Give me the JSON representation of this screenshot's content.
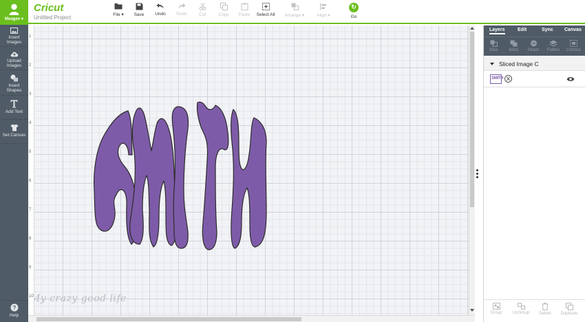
{
  "colors": {
    "accent": "#6abf1e",
    "sidebar": "#4f5b66",
    "letters": "#7e5ba8",
    "letters_stroke": "#2b2b2b"
  },
  "user": {
    "name": "Meagen",
    "icon": "user-icon"
  },
  "sidebar": {
    "items": [
      {
        "label_lines": [
          "Insert",
          "Images"
        ],
        "icon": "image-icon"
      },
      {
        "label_lines": [
          "Upload",
          "Images"
        ],
        "icon": "cloud-upload-icon"
      },
      {
        "label_lines": [
          "Insert",
          "Shapes"
        ],
        "icon": "shapes-icon"
      },
      {
        "label_lines": [
          "Add Text"
        ],
        "icon": "text-t-icon"
      },
      {
        "label_lines": [
          "Set Canvas"
        ],
        "icon": "tshirt-icon"
      }
    ],
    "help": {
      "label": "Help",
      "icon": "help-icon"
    }
  },
  "header": {
    "brand": "Cricut",
    "project_name": "Untitled Project",
    "toolbar": [
      {
        "label": "File ▾",
        "icon": "folder-icon",
        "enabled": true
      },
      {
        "label": "Save",
        "icon": "save-icon",
        "enabled": true
      },
      {
        "label": "Undo",
        "icon": "undo-icon",
        "enabled": true
      },
      {
        "label": "Redo",
        "icon": "redo-icon",
        "enabled": false
      },
      {
        "label": "Cut",
        "icon": "cut-icon",
        "enabled": false
      },
      {
        "label": "Copy",
        "icon": "copy-icon",
        "enabled": false
      },
      {
        "label": "Paste",
        "icon": "paste-icon",
        "enabled": false
      },
      {
        "label": "Select All",
        "icon": "select-all-icon",
        "enabled": true
      },
      {
        "label": "Arrange ▾",
        "icon": "arrange-icon",
        "enabled": false
      },
      {
        "label": "Align ▾",
        "icon": "align-icon",
        "enabled": false
      },
      {
        "label": "Go",
        "icon": "go-icon",
        "enabled": true
      }
    ]
  },
  "canvas": {
    "ruler_numbers": [
      "1",
      "2",
      "3",
      "4",
      "5",
      "6",
      "7",
      "8",
      "9",
      "10"
    ],
    "design_text": "SMITH",
    "watermark": "My crazy good life"
  },
  "panel": {
    "tabs": [
      "Layers",
      "Edit",
      "Sync",
      "Canvas"
    ],
    "active_tab": "Layers",
    "tools": [
      {
        "label": "Slice",
        "icon": "slice-icon"
      },
      {
        "label": "Weld",
        "icon": "weld-icon"
      },
      {
        "label": "Attach",
        "icon": "attach-icon"
      },
      {
        "label": "Flatten",
        "icon": "flatten-icon"
      },
      {
        "label": "Contour",
        "icon": "contour-icon"
      }
    ],
    "layer_group_name": "Sliced Image C",
    "layer_thumb_text": "SMITH",
    "bottom_tools": [
      {
        "label": "Group",
        "icon": "group-icon"
      },
      {
        "label": "UnGroup",
        "icon": "ungroup-icon"
      },
      {
        "label": "Delete",
        "icon": "trash-icon"
      },
      {
        "label": "Duplicate",
        "icon": "duplicate-icon"
      }
    ]
  }
}
